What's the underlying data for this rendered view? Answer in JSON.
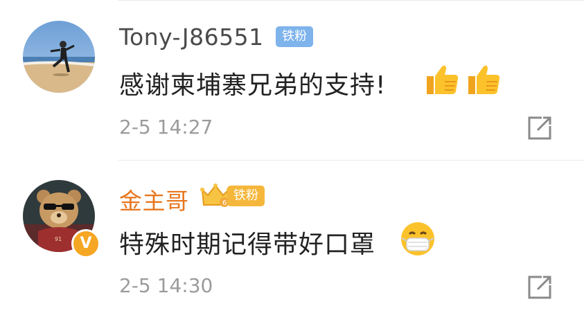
{
  "comments": [
    {
      "username": "Tony-J86551",
      "badge": "铁粉",
      "text": "感谢柬埔寨兄弟的支持!",
      "emojis": [
        "thumbs-up",
        "thumbs-up"
      ],
      "time": "2-5 14:27"
    },
    {
      "username": "金主哥",
      "badge": "铁粉",
      "crown_level": "6",
      "verified": "V",
      "text": "特殊时期记得带好口罩",
      "emojis": [
        "mask-face"
      ],
      "time": "2-5 14:30"
    }
  ],
  "colors": {
    "username_default": "#4a4a4a",
    "username_vip": "#e8761d",
    "badge_blue": "#7eb3ec",
    "badge_gold": "#f5b73b",
    "timestamp": "#9b9b9b"
  }
}
